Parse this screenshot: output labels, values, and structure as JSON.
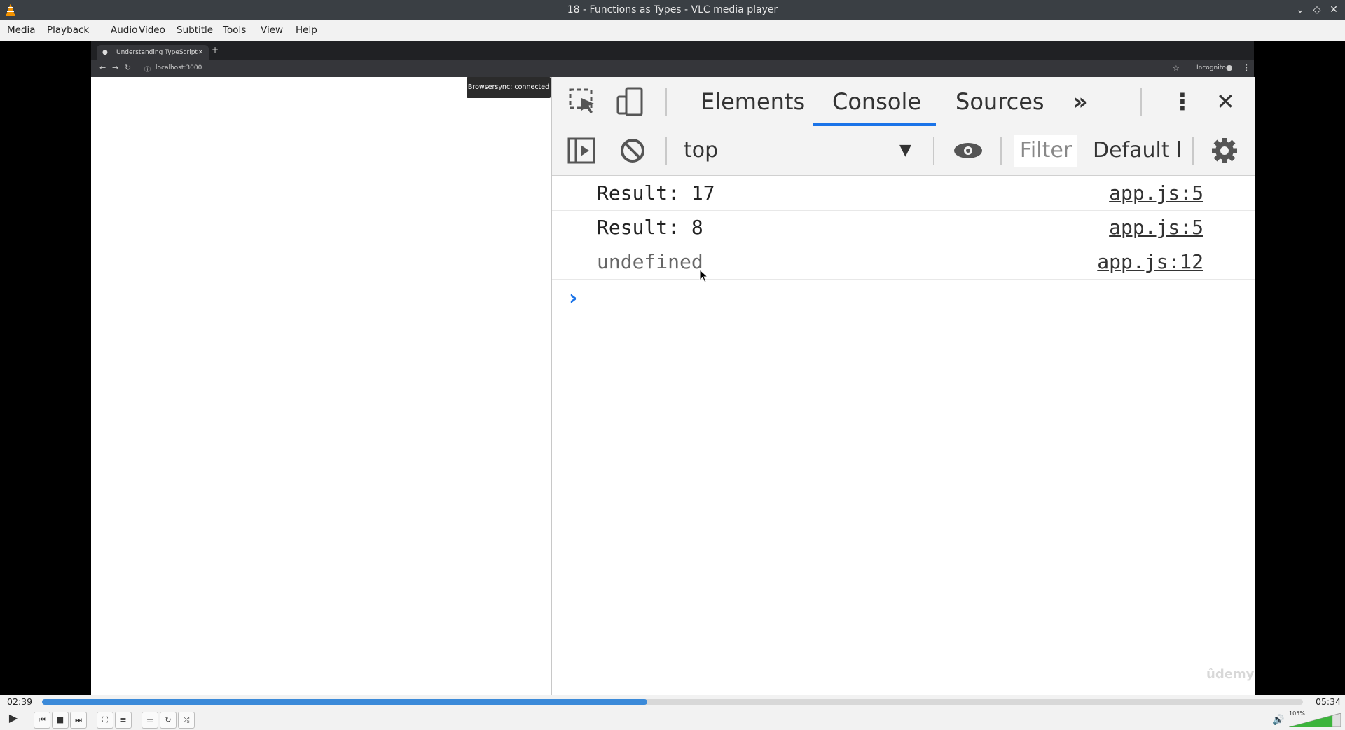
{
  "window": {
    "title": "18 - Functions as Types - VLC media player"
  },
  "menu": [
    "Media",
    "Playback",
    "Audio",
    "Video",
    "Subtitle",
    "Tools",
    "View",
    "Help"
  ],
  "browser": {
    "tab_title": "Understanding TypeScript",
    "url": "localhost:3000",
    "profile_label": "Incognito",
    "tooltip": "Browsersync: connected"
  },
  "devtools": {
    "tabs": [
      "Elements",
      "Console",
      "Sources"
    ],
    "active_tab": "Console",
    "context": "top",
    "filter_placeholder": "Filter",
    "levels": "Default l",
    "console_rows": [
      {
        "message": "Result: 17",
        "source": "app.js:5"
      },
      {
        "message": "Result: 8",
        "source": "app.js:5"
      },
      {
        "message": "undefined",
        "source": "app.js:12"
      }
    ]
  },
  "watermark": "ûdemy",
  "player": {
    "elapsed": "02:39",
    "total": "05:34",
    "progress": 0.48,
    "volume_label": "105%",
    "volume": 1.05
  },
  "colors": {
    "accent": "#1a73e8",
    "seek": "#3b8ad9"
  }
}
